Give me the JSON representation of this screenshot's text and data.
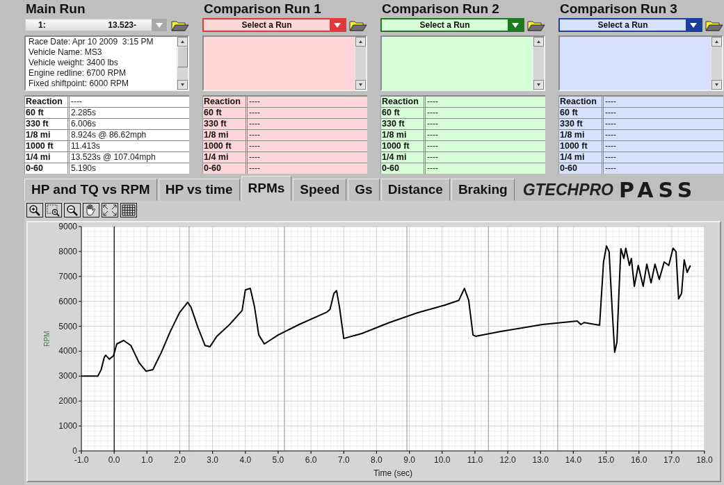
{
  "runs": [
    {
      "kind": "main",
      "title": "Main Run",
      "dropdown": {
        "label": "1:",
        "value": "13.523-"
      },
      "info_lines": [
        "Race Date: Apr 10 2009  3:15 PM",
        "Vehicle Name: MS3",
        "Vehicle weight: 3400 lbs",
        "Engine redline: 6700 RPM",
        "Fixed shiftpoint: 6000 RPM"
      ],
      "results": [
        {
          "label": "Reaction",
          "value": "----"
        },
        {
          "label": "60 ft",
          "value": "2.285s"
        },
        {
          "label": "330 ft",
          "value": "6.006s"
        },
        {
          "label": "1/8 mi",
          "value": "8.924s @ 86.62mph"
        },
        {
          "label": "1000 ft",
          "value": "11.413s"
        },
        {
          "label": "1/4 mi",
          "value": "13.523s @ 107.04mph"
        },
        {
          "label": "0-60",
          "value": "5.190s"
        }
      ]
    },
    {
      "kind": "comparison",
      "title": "Comparison Run 1",
      "color": "#e0383b",
      "dropdown": {
        "value": "Select a Run"
      },
      "results": [
        {
          "label": "Reaction",
          "value": "----"
        },
        {
          "label": "60 ft",
          "value": "----"
        },
        {
          "label": "330 ft",
          "value": "----"
        },
        {
          "label": "1/8 mi",
          "value": "----"
        },
        {
          "label": "1000 ft",
          "value": "----"
        },
        {
          "label": "1/4 mi",
          "value": "----"
        },
        {
          "label": "0-60",
          "value": "----"
        }
      ]
    },
    {
      "kind": "comparison",
      "title": "Comparison Run 2",
      "color": "#1e7a1e",
      "dropdown": {
        "value": "Select a Run"
      },
      "results": [
        {
          "label": "Reaction",
          "value": "----"
        },
        {
          "label": "60 ft",
          "value": "----"
        },
        {
          "label": "330 ft",
          "value": "----"
        },
        {
          "label": "1/8 mi",
          "value": "----"
        },
        {
          "label": "1000 ft",
          "value": "----"
        },
        {
          "label": "1/4 mi",
          "value": "----"
        },
        {
          "label": "0-60",
          "value": "----"
        }
      ]
    },
    {
      "kind": "comparison",
      "title": "Comparison Run 3",
      "color": "#1c3f9e",
      "dropdown": {
        "value": "Select a Run"
      },
      "results": [
        {
          "label": "Reaction",
          "value": "----"
        },
        {
          "label": "60 ft",
          "value": "----"
        },
        {
          "label": "330 ft",
          "value": "----"
        },
        {
          "label": "1/8 mi",
          "value": "----"
        },
        {
          "label": "1000 ft",
          "value": "----"
        },
        {
          "label": "1/4 mi",
          "value": "----"
        },
        {
          "label": "0-60",
          "value": "----"
        }
      ]
    }
  ],
  "tabs": [
    {
      "label": "HP and TQ vs RPM",
      "selected": false
    },
    {
      "label": "HP vs time",
      "selected": false
    },
    {
      "label": "RPMs",
      "selected": true
    },
    {
      "label": "Speed",
      "selected": false
    },
    {
      "label": "Gs",
      "selected": false
    },
    {
      "label": "Distance",
      "selected": false
    },
    {
      "label": "Braking",
      "selected": false
    }
  ],
  "logo": {
    "brand": "GTECHPRO",
    "product": "PASS"
  },
  "chart": {
    "chart_data": {
      "type": "line",
      "xlabel": "Time (sec)",
      "ylabel": "RPM",
      "grid": true,
      "xlim": [
        -1,
        18
      ],
      "ylim": [
        0,
        9000
      ],
      "xticks": [
        {
          "value": -1,
          "label": "-1.0"
        },
        {
          "value": 0,
          "label": "0.0"
        },
        {
          "value": 1,
          "label": "1.0"
        },
        {
          "value": 2,
          "label": "2.0"
        },
        {
          "value": 3,
          "label": "3.0"
        },
        {
          "value": 4,
          "label": "4.0"
        },
        {
          "value": 5,
          "label": "5.0"
        },
        {
          "value": 6,
          "label": "6.0"
        },
        {
          "value": 7,
          "label": "7.0"
        },
        {
          "value": 8,
          "label": "8.0"
        },
        {
          "value": 9,
          "label": "9.0"
        },
        {
          "value": 10,
          "label": "10.0"
        },
        {
          "value": 11,
          "label": "11.0"
        },
        {
          "value": 12,
          "label": "12.0"
        },
        {
          "value": 13,
          "label": "13.0"
        },
        {
          "value": 14,
          "label": "14.0"
        },
        {
          "value": 15,
          "label": "15.0"
        },
        {
          "value": 16,
          "label": "16.0"
        },
        {
          "value": 17,
          "label": "17.0"
        },
        {
          "value": 18,
          "label": "18.0"
        }
      ],
      "yticks": [
        0,
        1000,
        2000,
        3000,
        4000,
        5000,
        6000,
        7000,
        8000,
        9000
      ],
      "x": [
        -1.0,
        -0.5,
        -0.4,
        -0.3,
        -0.26,
        -0.15,
        -0.02,
        0.08,
        0.29,
        0.51,
        0.76,
        0.97,
        1.18,
        1.44,
        1.71,
        1.99,
        2.24,
        2.34,
        2.56,
        2.77,
        2.92,
        3.13,
        3.52,
        3.9,
        4.0,
        4.15,
        4.28,
        4.41,
        4.58,
        5.0,
        5.64,
        6.49,
        6.58,
        6.7,
        6.78,
        6.87,
        7.0,
        7.55,
        8.39,
        9.24,
        10.09,
        10.51,
        10.68,
        10.81,
        10.94,
        11.02,
        11.79,
        13.06,
        14.12,
        14.23,
        14.33,
        14.8,
        14.92,
        15.01,
        15.09,
        15.18,
        15.26,
        15.33,
        15.39,
        15.45,
        15.54,
        15.6,
        15.71,
        15.77,
        15.86,
        15.98,
        16.13,
        16.24,
        16.37,
        16.49,
        16.62,
        16.77,
        16.91,
        17.04,
        17.13,
        17.21,
        17.3,
        17.38,
        17.47,
        17.57
      ],
      "series": [
        {
          "color": "#000000",
          "values": [
            3000,
            3000,
            3250,
            3760,
            3840,
            3680,
            3820,
            4290,
            4430,
            4230,
            3540,
            3200,
            3260,
            3960,
            4790,
            5540,
            5960,
            5770,
            4930,
            4230,
            4180,
            4600,
            5070,
            5630,
            6460,
            6520,
            5770,
            4650,
            4290,
            4650,
            5070,
            5570,
            5680,
            6320,
            6430,
            5770,
            4510,
            4710,
            5150,
            5540,
            5850,
            6040,
            6520,
            6040,
            4650,
            4600,
            4790,
            5070,
            5210,
            5070,
            5150,
            5040,
            7580,
            8220,
            7990,
            5770,
            3960,
            4370,
            6320,
            8110,
            7720,
            8130,
            7440,
            7720,
            6600,
            7440,
            6600,
            7490,
            6740,
            7490,
            6880,
            7580,
            7440,
            8130,
            7990,
            6100,
            6320,
            7660,
            7160,
            7440
          ]
        }
      ],
      "ref_lines": [
        {
          "axis": "x",
          "value": 0,
          "color": "#000000"
        },
        {
          "axis": "x",
          "value": 2.285,
          "color": "#a6a6a6"
        },
        {
          "axis": "x",
          "value": 5.19,
          "color": "#a6a6a6"
        },
        {
          "axis": "x",
          "value": 8.924,
          "color": "#a6a6a6"
        },
        {
          "axis": "x",
          "value": 11.413,
          "color": "#a6a6a6"
        },
        {
          "axis": "x",
          "value": 13.523,
          "color": "#a6a6a6"
        }
      ]
    }
  }
}
